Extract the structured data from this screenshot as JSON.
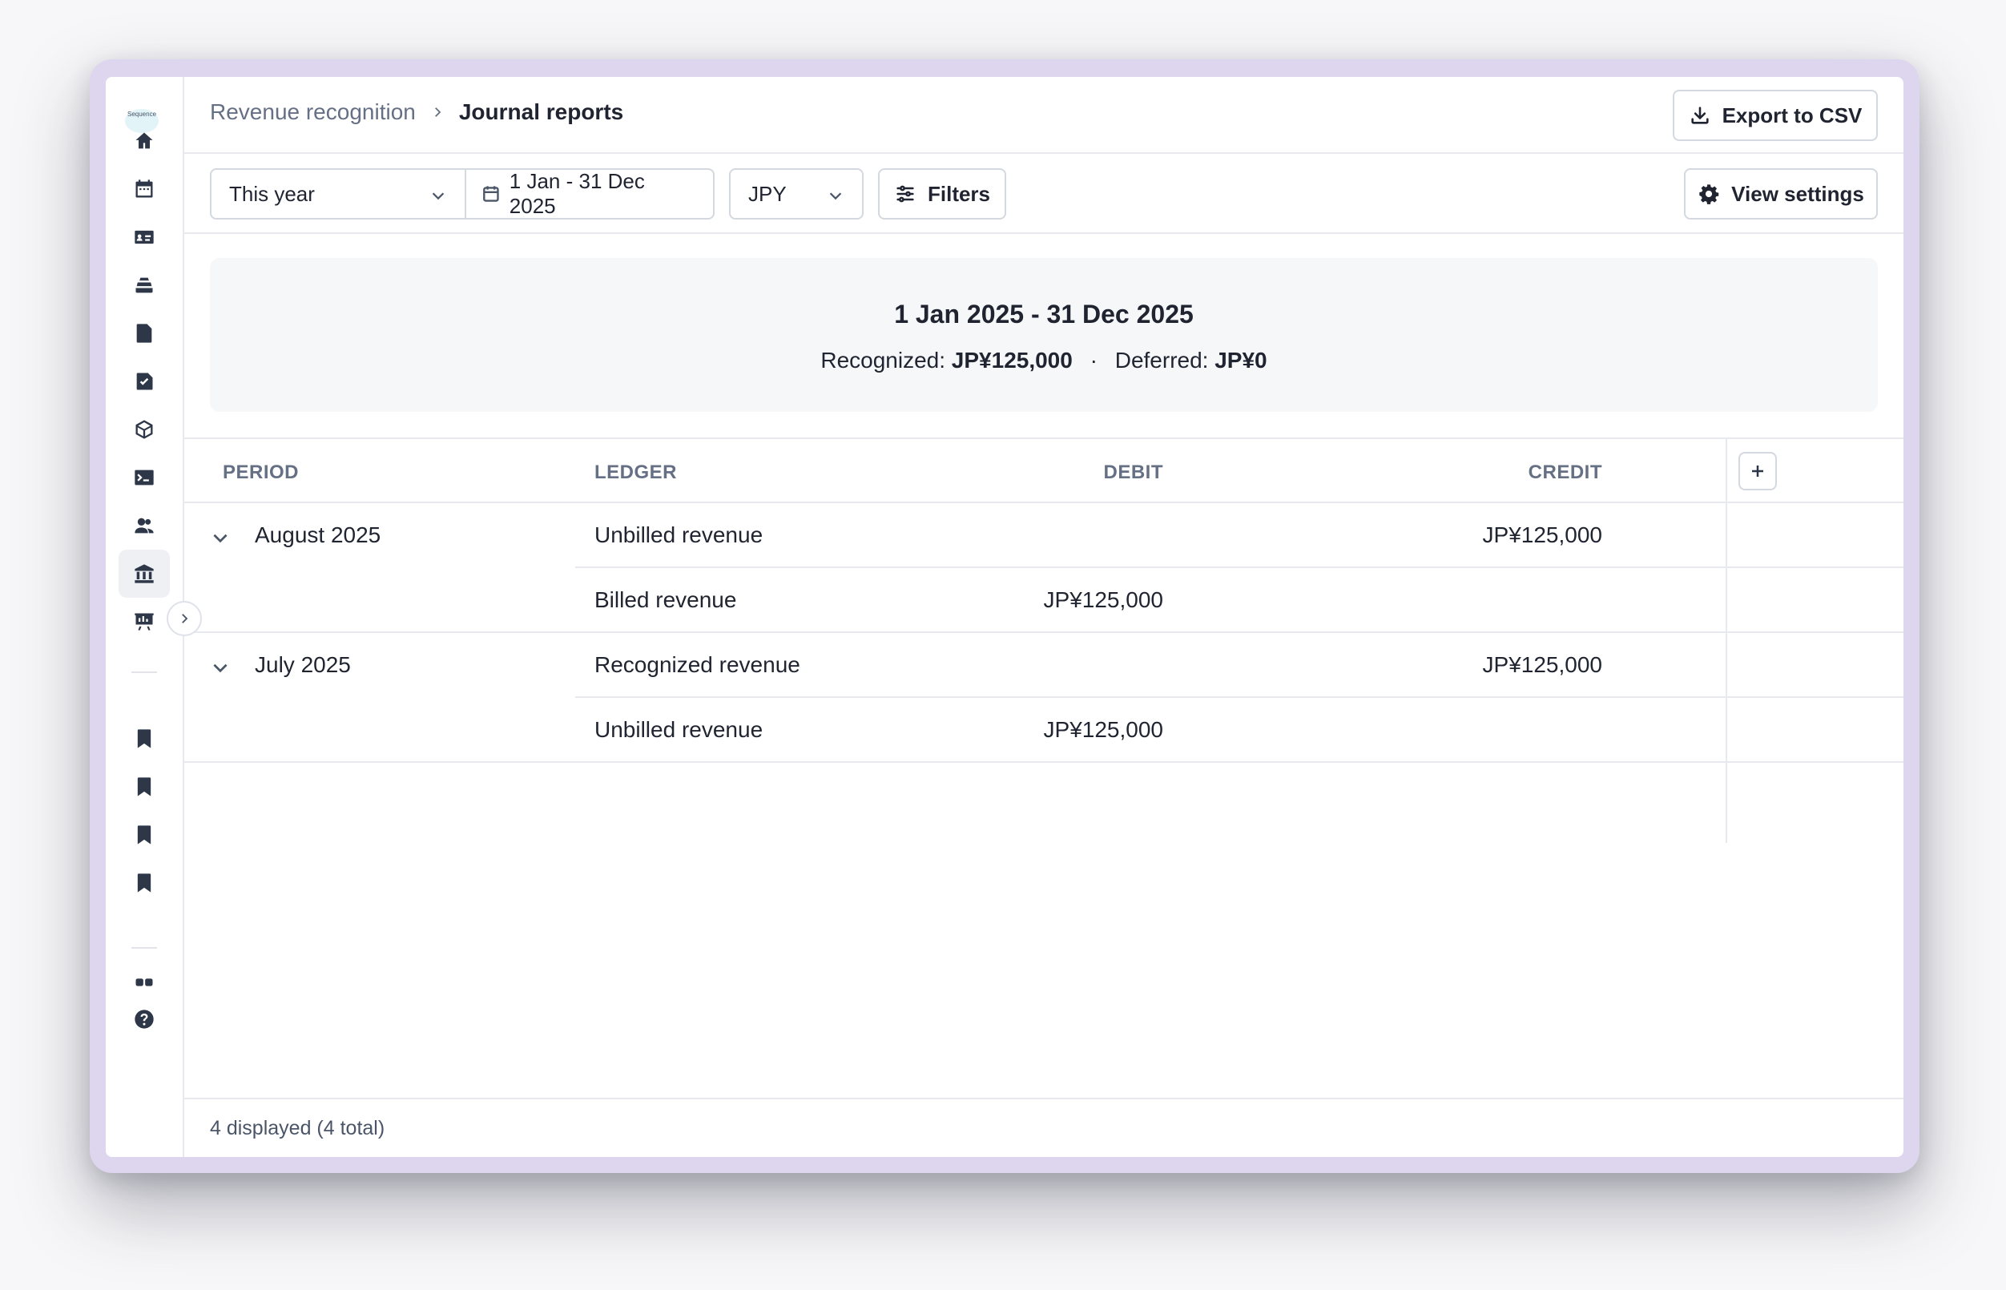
{
  "app": {
    "logo_text": "Sequence"
  },
  "sidebar": {
    "items": [
      {
        "icon": "home-icon",
        "active": false
      },
      {
        "icon": "calendar-icon",
        "active": false
      },
      {
        "icon": "id-card-icon",
        "active": false
      },
      {
        "icon": "stack-icon",
        "active": false
      },
      {
        "icon": "document-refresh-icon",
        "active": false
      },
      {
        "icon": "checkbox-icon",
        "active": false
      },
      {
        "icon": "cube-icon",
        "active": false
      },
      {
        "icon": "terminal-icon",
        "active": false
      },
      {
        "icon": "users-icon",
        "active": false
      },
      {
        "icon": "bank-icon",
        "active": true
      },
      {
        "icon": "presentation-chart-icon",
        "active": false
      }
    ],
    "bookmarks": [
      "bookmark-icon",
      "bookmark-icon",
      "bookmark-icon",
      "bookmark-icon"
    ],
    "bottom": [
      "apps-icon",
      "help-icon"
    ]
  },
  "header": {
    "breadcrumb_parent": "Revenue recognition",
    "breadcrumb_current": "Journal reports",
    "export_label": "Export to CSV"
  },
  "filters": {
    "period": "This year",
    "date_range": "1 Jan - 31 Dec 2025",
    "currency": "JPY",
    "filters_label": "Filters",
    "view_settings_label": "View settings"
  },
  "summary": {
    "title": "1 Jan 2025 - 31 Dec 2025",
    "recognized_label": "Recognized:",
    "recognized_value": "JP¥125,000",
    "separator": "·",
    "deferred_label": "Deferred:",
    "deferred_value": "JP¥0"
  },
  "table": {
    "columns": {
      "period": "PERIOD",
      "ledger": "LEDGER",
      "debit": "DEBIT",
      "credit": "CREDIT"
    },
    "rows": [
      {
        "period": "August 2025",
        "ledger": "Unbilled revenue",
        "debit": "",
        "credit": "JP¥125,000"
      },
      {
        "period": "",
        "ledger": "Billed revenue",
        "debit": "JP¥125,000",
        "credit": ""
      },
      {
        "period": "July 2025",
        "ledger": "Recognized revenue",
        "debit": "",
        "credit": "JP¥125,000"
      },
      {
        "period": "",
        "ledger": "Unbilled revenue",
        "debit": "JP¥125,000",
        "credit": ""
      }
    ]
  },
  "footer": {
    "count_text": "4 displayed (4 total)"
  },
  "colors": {
    "frame": "#ddd6ee",
    "text": "#1f2430",
    "muted": "#667085",
    "border": "#e7e9ee"
  }
}
